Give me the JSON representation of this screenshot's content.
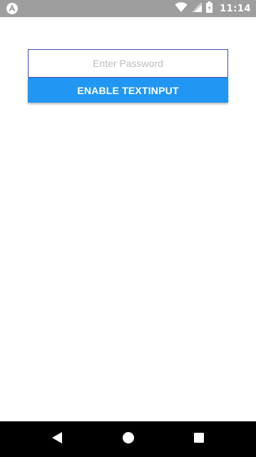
{
  "status_bar": {
    "time": "11:14",
    "icons": [
      "app-notification-icon",
      "wifi-icon",
      "cell-signal-icon",
      "battery-icon"
    ],
    "background": "#9e9e9e"
  },
  "form": {
    "password_placeholder": "Enter Password",
    "password_value": "",
    "enable_button_label": "ENABLE TEXTINPUT",
    "button_color": "#2196f3",
    "input_border_color": "#3f51b5"
  },
  "nav_bar": {
    "buttons": [
      "back-icon",
      "home-icon",
      "recents-icon"
    ]
  }
}
